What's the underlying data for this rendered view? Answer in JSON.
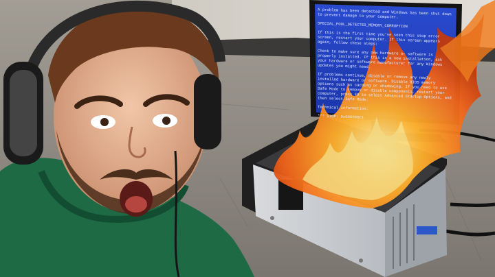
{
  "scene": {
    "description_tags": [
      "person-headphones",
      "monitor-bsod",
      "pc-tower-on-fire"
    ]
  },
  "bsod_screen": {
    "line_1": "A problem has been detected and Windows has been shut down to prevent damage to your computer.",
    "line_2": "SPECIAL_POOL_DETECTED_MEMORY_CORRUPTION",
    "line_3": "If this is the first time you've seen this stop error screen, restart your computer. If this screen appears again, follow these steps:",
    "line_4": "Check to make sure any new hardware or software is properly installed. If this is a new installation, ask your hardware or software manufacturer for any Windows updates you might need.",
    "line_5": "If problems continue, disable or remove any newly installed hardware or software. Disable BIOS memory options such as caching or shadowing. If you need to use Safe Mode to remove or disable components, restart your computer, press F8 to select Advanced Startup Options, and then select Safe Mode.",
    "line_6": "Technical information:",
    "line_7": "*** STOP: 0x000000C1"
  },
  "colors": {
    "bsod_blue": "#1f3fbf",
    "hoodie_green": "#1d6a45",
    "fire_orange": "#ff8a1c",
    "floor": "#8e8a84"
  }
}
